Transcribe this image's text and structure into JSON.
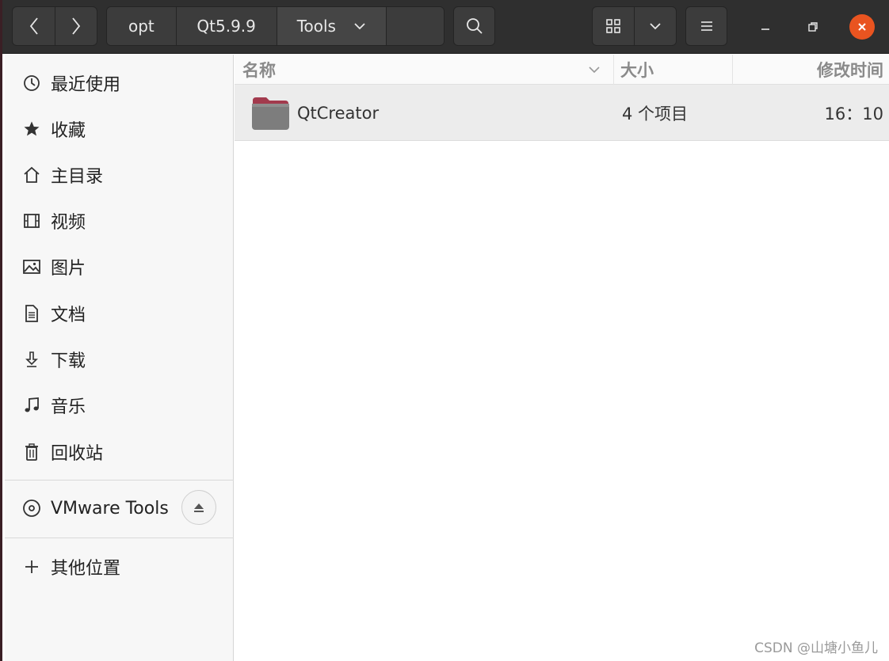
{
  "header": {
    "path": [
      "opt",
      "Qt5.9.9",
      "Tools"
    ]
  },
  "sidebar": {
    "items": [
      {
        "label": "最近使用",
        "icon": "recent-icon"
      },
      {
        "label": "收藏",
        "icon": "star-icon"
      },
      {
        "label": "主目录",
        "icon": "home-icon"
      },
      {
        "label": "视频",
        "icon": "video-icon"
      },
      {
        "label": "图片",
        "icon": "picture-icon"
      },
      {
        "label": "文档",
        "icon": "document-icon"
      },
      {
        "label": "下载",
        "icon": "download-icon"
      },
      {
        "label": "音乐",
        "icon": "music-icon"
      },
      {
        "label": "回收站",
        "icon": "trash-icon"
      }
    ],
    "devices": [
      {
        "label": "VMware Tools",
        "icon": "disc-icon"
      }
    ],
    "other": {
      "label": "其他位置",
      "icon": "plus-icon"
    }
  },
  "columns": {
    "name": "名称",
    "size": "大小",
    "modified": "修改时间"
  },
  "files": [
    {
      "name": "QtCreator",
      "size": "4 个项目",
      "modified": "16：10",
      "icon": "folder-icon"
    }
  ],
  "watermark": "CSDN @山塘小鱼儿",
  "colors": {
    "header_bg": "#2f2f2f",
    "close_button": "#e95420",
    "folder": "#8a8a8a",
    "folder_tab": "#a23a4d"
  }
}
